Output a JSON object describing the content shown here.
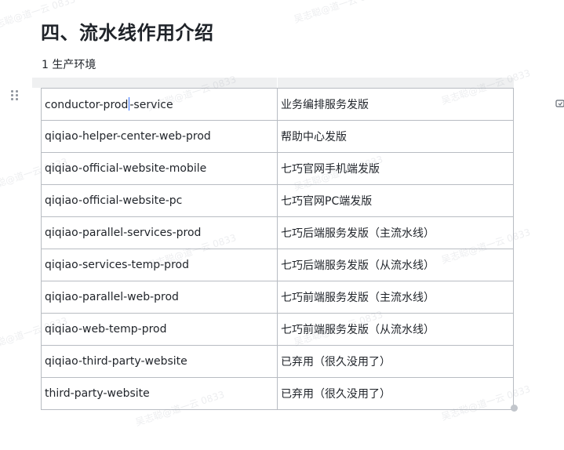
{
  "document": {
    "heading": "四、流水线作用介绍",
    "section_label": "1  生产环境"
  },
  "table": {
    "rows": [
      {
        "pipeline": "conductor-prod-service",
        "description": "业务编排服务发版"
      },
      {
        "pipeline": "qiqiao-helper-center-web-prod",
        "description": "帮助中心发版"
      },
      {
        "pipeline": "qiqiao-official-website-mobile",
        "description": "七巧官网手机端发版"
      },
      {
        "pipeline": "qiqiao-official-website-pc",
        "description": "七巧官网PC端发版"
      },
      {
        "pipeline": "qiqiao-parallel-services-prod",
        "description": "七巧后端服务发版（主流水线）"
      },
      {
        "pipeline": "qiqiao-services-temp-prod",
        "description": "七巧后端服务发版（从流水线）"
      },
      {
        "pipeline": "qiqiao-parallel-web-prod",
        "description": "七巧前端服务发版（主流水线）"
      },
      {
        "pipeline": "qiqiao-web-temp-prod",
        "description": "七巧前端服务发版（从流水线）"
      },
      {
        "pipeline": "qiqiao-third-party-website",
        "description": "已弃用（很久没用了）"
      },
      {
        "pipeline": "third-party-website",
        "description": "已弃用（很久没用了）"
      }
    ]
  },
  "text_cursor": {
    "row": 0,
    "after_chars": 14
  },
  "watermark_text": "吴志聪@道一云 0833",
  "icons": {
    "drag_handle": "drag-handle-icon",
    "comment": "comment-add-icon",
    "resize": "table-resize-handle"
  },
  "colors": {
    "text": "#1f2329",
    "cell_border": "#b8bcc2",
    "header_strip": "#eff0f1",
    "cursor": "#3370ff"
  }
}
